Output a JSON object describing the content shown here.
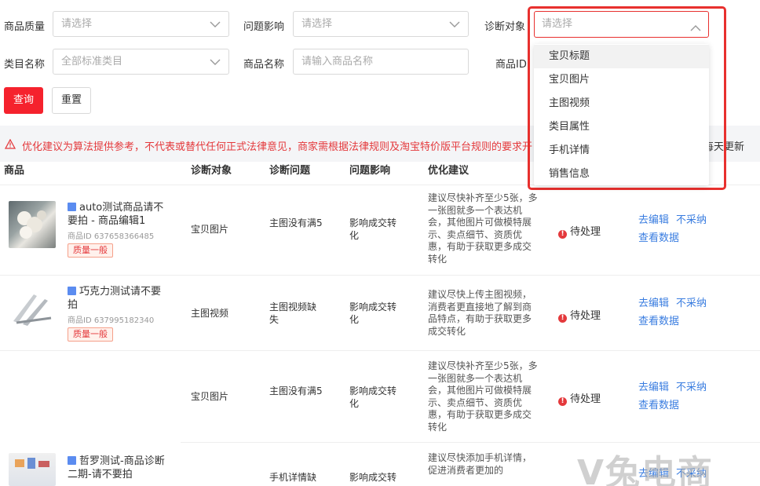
{
  "filters": {
    "quality": {
      "label": "商品质量",
      "placeholder": "请选择"
    },
    "impact": {
      "label": "问题影响",
      "placeholder": "请选择"
    },
    "target": {
      "label": "诊断对象",
      "placeholder": "请选择"
    },
    "category": {
      "label": "类目名称",
      "placeholder": "全部标准类目"
    },
    "product_name": {
      "label": "商品名称",
      "placeholder": "请输入商品名称"
    },
    "product_id": {
      "label": "商品ID"
    }
  },
  "buttons": {
    "query": "查询",
    "reset": "重置"
  },
  "notice": {
    "text": "优化建议为算法提供参考，不代表或替代任何正式法律意见，商家需根据法律规则及淘宝特价版平台规则的要求开",
    "tail": "每天更新"
  },
  "columns": [
    "商品",
    "诊断对象",
    "诊断问题",
    "问题影响",
    "优化建议"
  ],
  "dropdown": {
    "options": [
      "宝贝标题",
      "宝贝图片",
      "主图视频",
      "类目属性",
      "手机详情",
      "销售信息"
    ]
  },
  "rows": [
    {
      "name": "auto测试商品请不要拍 - 商品编辑1",
      "id": "商品ID 637658366485",
      "badge": "质量一般",
      "target": "宝贝图片",
      "problem": "主图没有满5",
      "impact": "影响成交转化",
      "suggest": "建议尽快补齐至少5张，多一张图就多一个表达机会，其他图片可做模特展示、卖点细节、资质优惠，有助于获取更多成交转化",
      "status": "待处理",
      "action_edit": "去编辑",
      "action_reject": "不采纳",
      "action_data": "查看数据"
    },
    {
      "name": "巧克力测试请不要拍",
      "id": "商品ID 637995182340",
      "badge": "质量一般",
      "target": "主图视频",
      "problem": "主图视频缺失",
      "impact": "影响成交转化",
      "suggest": "建议尽快上传主图视频，消费者更直接地了解到商品特点，有助于获取更多成交转化",
      "status": "待处理",
      "action_edit": "去编辑",
      "action_reject": "不采纳",
      "action_data": "查看数据"
    },
    {
      "name": "",
      "id": "",
      "badge": "",
      "target": "宝贝图片",
      "problem": "主图没有满5",
      "impact": "影响成交转化",
      "suggest": "建议尽快补齐至少5张，多一张图就多一个表达机会，其他图片可做模特展示、卖点细节、资质优惠，有助于获取更多成交转化",
      "status": "待处理",
      "action_edit": "去编辑",
      "action_reject": "不采纳",
      "action_data": "查看数据"
    },
    {
      "name": "哲罗测试-商品诊断二期-请不要拍",
      "target": "",
      "problem": "手机详情缺",
      "impact": "影响成交转",
      "suggest": "建议尽快添加手机详情，促进消费者更加的",
      "action_edit": "去编辑",
      "action_reject": "不采纳"
    }
  ],
  "watermark": "V兔电商"
}
